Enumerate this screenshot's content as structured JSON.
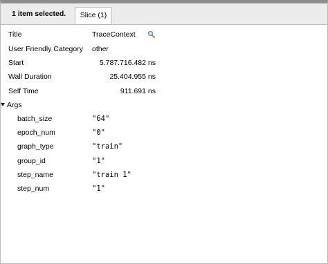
{
  "header": {
    "selection_label": "1 item selected.",
    "tab_label": "Slice (1)"
  },
  "details": {
    "title_key": "Title",
    "title_value": "TraceContext",
    "category_key": "User Friendly Category",
    "category_value": "other",
    "start_key": "Start",
    "start_value": "5.787.716.482 ns",
    "wall_key": "Wall Duration",
    "wall_value": "25.404.955 ns",
    "self_key": "Self Time",
    "self_value": "911.691 ns"
  },
  "args": {
    "label": "Args",
    "items": [
      {
        "key": "batch_size",
        "value": "\"64\""
      },
      {
        "key": "epoch_num",
        "value": "\"0\""
      },
      {
        "key": "graph_type",
        "value": "\"train\""
      },
      {
        "key": "group_id",
        "value": "\"1\""
      },
      {
        "key": "step_name",
        "value": "\"train 1\""
      },
      {
        "key": "step_num",
        "value": "\"1\""
      }
    ]
  },
  "icons": {
    "search": "search-icon",
    "expand": "triangle-down-icon"
  }
}
